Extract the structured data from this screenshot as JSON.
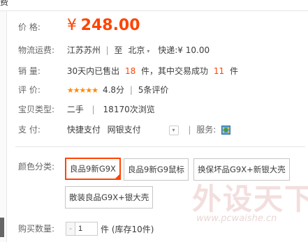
{
  "colors": {
    "accent": "#ff4400",
    "star": "#ff8a00",
    "label": "#666666"
  },
  "top_fragment": "费",
  "price": {
    "label": "价    格:",
    "currency": "¥",
    "value": "248.00"
  },
  "shipping": {
    "label": "物流运费:",
    "from": "江苏苏州",
    "sep": "|",
    "to_prefix": "至",
    "to": "北京",
    "express": "快递:¥ 10.00",
    "dropdown_icon": "chevron-down-icon"
  },
  "sales": {
    "label": "销    量:",
    "prefix": "30天内已售出",
    "count": "18",
    "mid": "件，其中交易成功",
    "success": "11",
    "suffix": "件"
  },
  "rating": {
    "label": "评    价:",
    "stars": "★★★★★",
    "score": "4.8分",
    "sep": "|",
    "reviews": "5条评价"
  },
  "item_type": {
    "label": "宝贝类型:",
    "condition": "二手",
    "sep": "|",
    "views": "18170次浏览"
  },
  "payment": {
    "label": "支    付:",
    "method1": "快捷支付",
    "method2": "网银支付",
    "sep": "|",
    "service_label": "服务:",
    "dropdown_icon": "chevron-down-icon"
  },
  "color": {
    "label": "颜色分类:",
    "options": [
      {
        "text": "良品9新G9X",
        "selected": true
      },
      {
        "text": "良品9新G9鼠标",
        "selected": false
      },
      {
        "text": "换保坏品G9X+新银大壳",
        "selected": false
      },
      {
        "text": "散装良品G9X+银大壳",
        "selected": false
      }
    ]
  },
  "quantity": {
    "label": "购买数量:",
    "minus": "-",
    "value": "1",
    "stock": "件 (库存10件)"
  },
  "watermark": {
    "big": "外设天下",
    "url": "www.pcwaishe.cn"
  }
}
